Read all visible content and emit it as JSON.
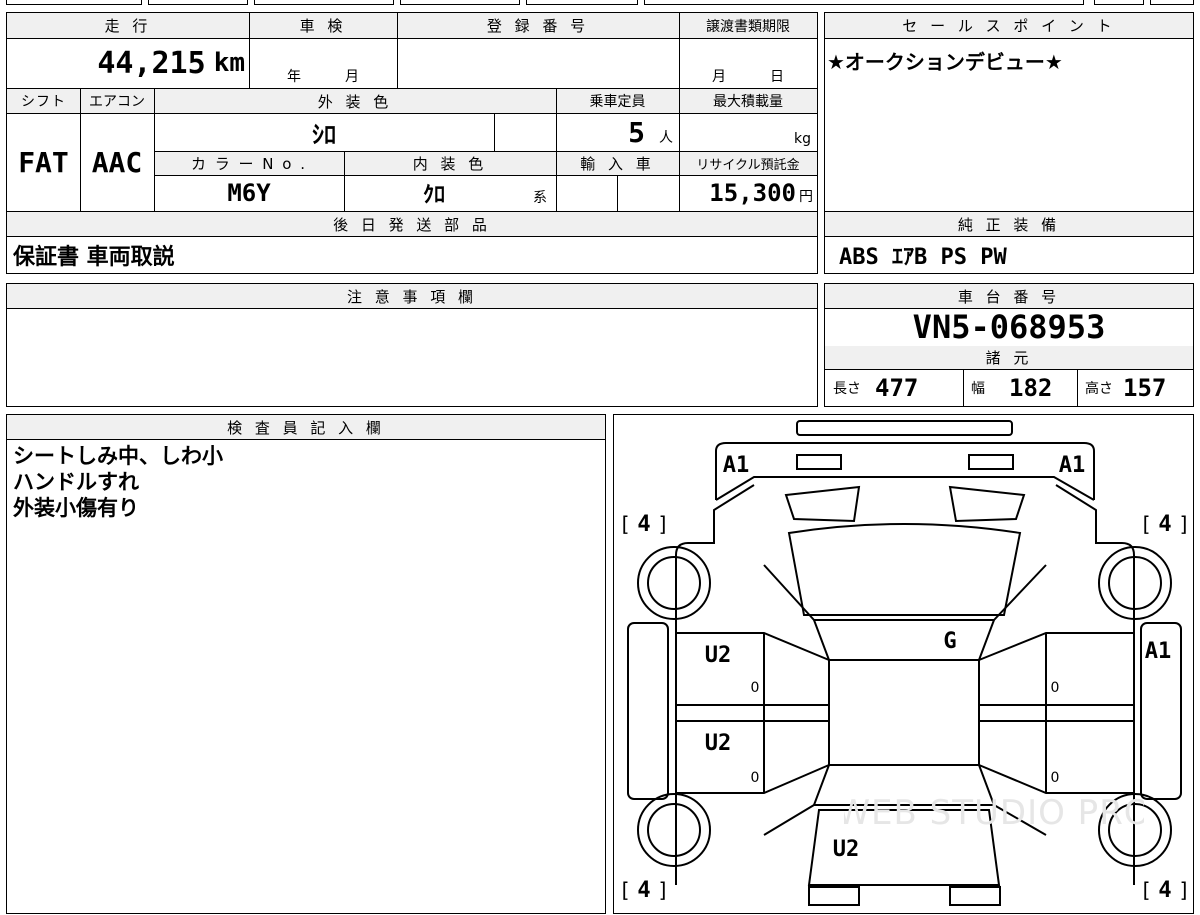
{
  "top_info": {
    "h_mileage": "走 行",
    "h_inspection": "車 検",
    "h_registration": "登 録 番 号",
    "h_transfer_deadline": "譲渡書類期限",
    "mileage": "44,215",
    "mileage_unit": "km",
    "inspection_year_unit": "年",
    "inspection_month_unit": "月",
    "transfer_month_unit": "月",
    "transfer_day_unit": "日"
  },
  "mid_info": {
    "h_shift": "シフト",
    "h_aircon": "エアコン",
    "h_exterior": "外 装 色",
    "h_capacity": "乗車定員",
    "h_max_load": "最大積載量",
    "shift": "FAT",
    "aircon": "AAC",
    "exterior_color": "ｼﾛ",
    "capacity": "5",
    "capacity_unit": "人",
    "max_load_unit": "kg",
    "h_color_no": "カ ラ ー N o .",
    "h_interior": "内 装 色",
    "h_import": "輸 入 車",
    "h_recycle": "リサイクル預託金",
    "color_no": "M6Y",
    "interior_color": "ｸﾛ",
    "interior_suffix": "系",
    "recycle_fee": "15,300",
    "recycle_unit": "円"
  },
  "later_parts": {
    "header": "後 日 発 送 部 品",
    "value": "保証書 車両取説"
  },
  "sales_point": {
    "header": "セ ー ル ス ポ イ ン ト",
    "value": "★オークションデビュー★"
  },
  "equipment": {
    "header": "純 正 装 備",
    "value": "ABS ｴｱB PS PW"
  },
  "caution": {
    "header": "注 意 事 項 欄"
  },
  "chassis": {
    "header": "車 台 番 号",
    "value": "VN5-068953"
  },
  "specs": {
    "header": "諸 元",
    "length_label": "長さ",
    "length": "477",
    "width_label": "幅",
    "width": "182",
    "height_label": "高さ",
    "height": "157"
  },
  "inspector": {
    "header": "検 査 員 記 入 欄",
    "lines": [
      "シートしみ中、しわ小",
      "ハンドルすれ",
      "外装小傷有り"
    ]
  },
  "diagram": {
    "marks": {
      "front_left": "A1",
      "front_right": "A1",
      "tire_fl": "4",
      "tire_fr": "4",
      "tire_rl": "4",
      "tire_rr": "4",
      "windshield": "G",
      "right_side": "A1",
      "left_front_door": "U2",
      "left_rear_door": "U2",
      "rear": "U2",
      "zero_1": "0",
      "zero_2": "0",
      "zero_3": "0",
      "zero_4": "0"
    },
    "watermark": "WEB STUDIO PRO"
  }
}
